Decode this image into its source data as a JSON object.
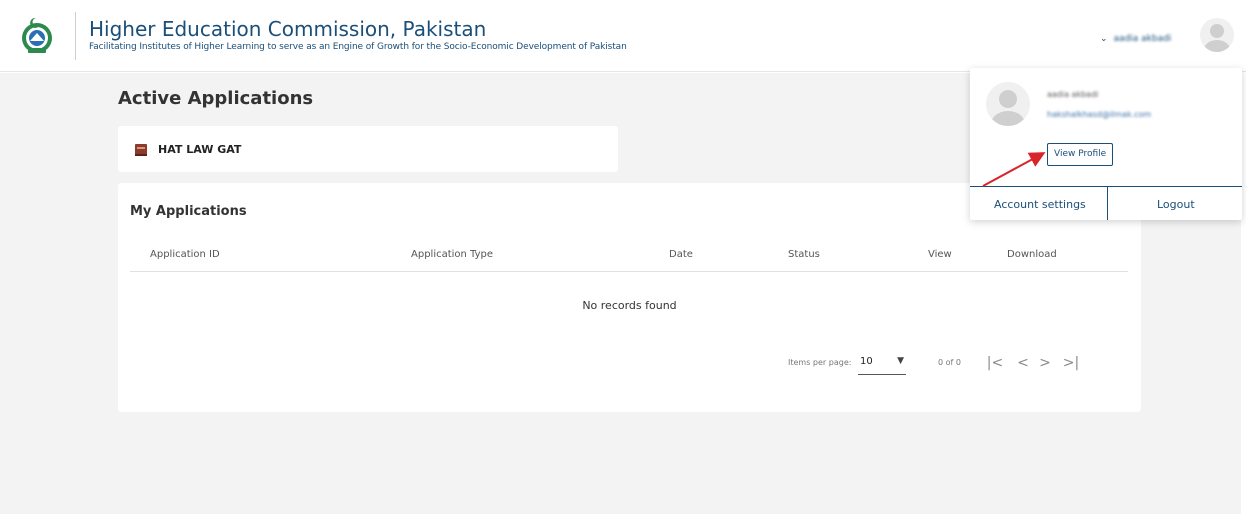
{
  "header": {
    "title": "Higher Education Commission, Pakistan",
    "tagline": "Facilitating Institutes of Higher Learning to serve as an Engine of Growth for the Socio-Economic Development of Pakistan",
    "user_name": "aadia akbadi",
    "chevron": "⌄"
  },
  "active_applications": {
    "title": "Active Applications",
    "items": [
      {
        "label": "HAT LAW GAT",
        "icon": "book-icon"
      }
    ]
  },
  "my_applications": {
    "title": "My Applications",
    "columns": [
      "Application ID",
      "Application Type",
      "Date",
      "Status",
      "View",
      "Download"
    ],
    "empty_text": "No records found",
    "paginator": {
      "items_per_page_label": "Items per page:",
      "items_per_page_value": "10",
      "range_label": "0 of 0",
      "first": "|<",
      "prev": "<",
      "next": ">",
      "last": ">|"
    }
  },
  "profile_dropdown": {
    "name": "aadia akbadi",
    "email": "hakshalkhasd@ilmak.com",
    "view_profile_label": "View Profile",
    "account_settings_label": "Account settings",
    "logout_label": "Logout"
  },
  "colors": {
    "brand": "#1a4f7a",
    "background": "#f3f3f3",
    "arrow": "#d9242b"
  }
}
